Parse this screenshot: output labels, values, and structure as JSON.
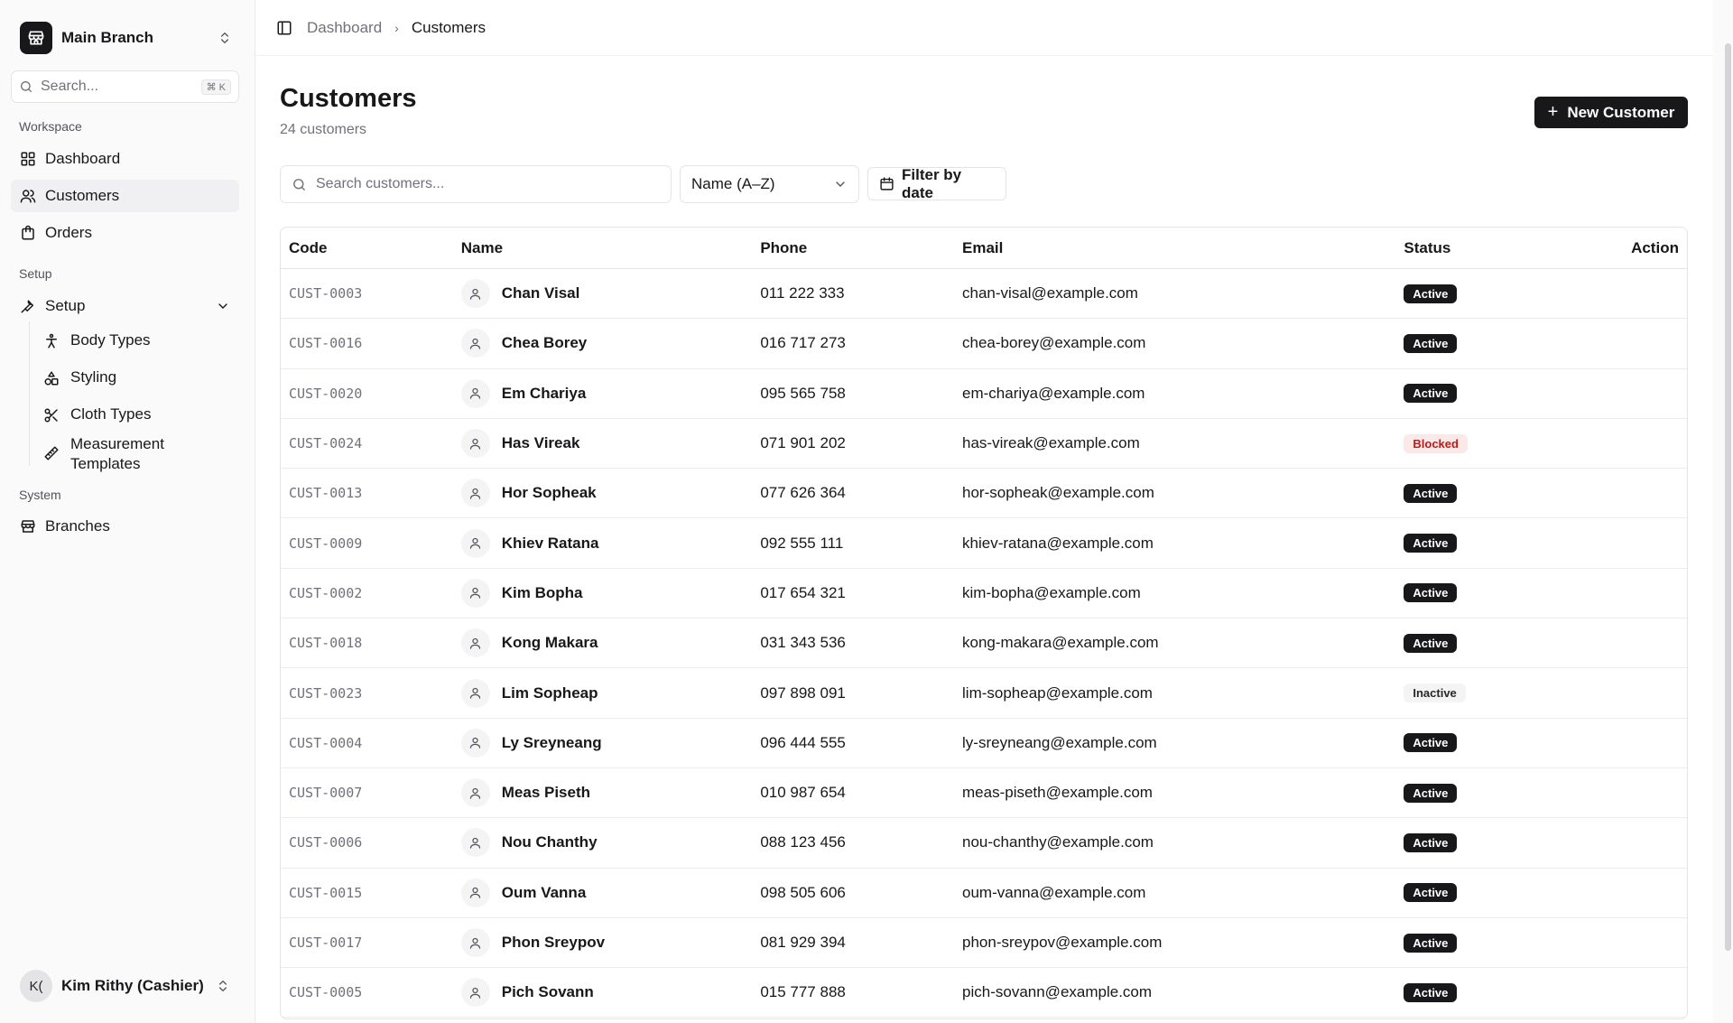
{
  "sidebar": {
    "branch_name": "Main Branch",
    "search_placeholder": "Search...",
    "search_shortcut": "⌘ K",
    "sections": {
      "workspace": "Workspace",
      "setup": "Setup",
      "system": "System"
    },
    "workspace_items": [
      {
        "label": "Dashboard",
        "icon": "grid-icon"
      },
      {
        "label": "Customers",
        "icon": "users-icon"
      },
      {
        "label": "Orders",
        "icon": "bag-icon"
      }
    ],
    "setup_group_label": "Setup",
    "setup_items": [
      {
        "label": "Body Types",
        "icon": "person-icon"
      },
      {
        "label": "Styling",
        "icon": "shapes-icon"
      },
      {
        "label": "Cloth Types",
        "icon": "scissors-icon"
      },
      {
        "label": "Measurement Templates",
        "icon": "ruler-icon"
      }
    ],
    "system_items": [
      {
        "label": "Branches",
        "icon": "store-icon"
      }
    ],
    "user": {
      "initials": "K(",
      "name": "Kim Rithy (Cashier)"
    }
  },
  "breadcrumb": {
    "parent": "Dashboard",
    "current": "Customers"
  },
  "page": {
    "title": "Customers",
    "count_text": "24 customers",
    "new_button": "New Customer"
  },
  "filters": {
    "search_placeholder": "Search customers...",
    "sort_value": "Name (A–Z)",
    "date_button": "Filter by date"
  },
  "table": {
    "headers": {
      "code": "Code",
      "name": "Name",
      "phone": "Phone",
      "email": "Email",
      "status": "Status",
      "action": "Action"
    },
    "rows": [
      {
        "code": "CUST-0003",
        "name": "Chan Visal",
        "phone": "011 222 333",
        "email": "chan-visal@example.com",
        "status": "Active"
      },
      {
        "code": "CUST-0016",
        "name": "Chea Borey",
        "phone": "016 717 273",
        "email": "chea-borey@example.com",
        "status": "Active"
      },
      {
        "code": "CUST-0020",
        "name": "Em Chariya",
        "phone": "095 565 758",
        "email": "em-chariya@example.com",
        "status": "Active"
      },
      {
        "code": "CUST-0024",
        "name": "Has Vireak",
        "phone": "071 901 202",
        "email": "has-vireak@example.com",
        "status": "Blocked"
      },
      {
        "code": "CUST-0013",
        "name": "Hor Sopheak",
        "phone": "077 626 364",
        "email": "hor-sopheak@example.com",
        "status": "Active"
      },
      {
        "code": "CUST-0009",
        "name": "Khiev Ratana",
        "phone": "092 555 111",
        "email": "khiev-ratana@example.com",
        "status": "Active"
      },
      {
        "code": "CUST-0002",
        "name": "Kim Bopha",
        "phone": "017 654 321",
        "email": "kim-bopha@example.com",
        "status": "Active"
      },
      {
        "code": "CUST-0018",
        "name": "Kong Makara",
        "phone": "031 343 536",
        "email": "kong-makara@example.com",
        "status": "Active"
      },
      {
        "code": "CUST-0023",
        "name": "Lim Sopheap",
        "phone": "097 898 091",
        "email": "lim-sopheap@example.com",
        "status": "Inactive"
      },
      {
        "code": "CUST-0004",
        "name": "Ly Sreyneang",
        "phone": "096 444 555",
        "email": "ly-sreyneang@example.com",
        "status": "Active"
      },
      {
        "code": "CUST-0007",
        "name": "Meas Piseth",
        "phone": "010 987 654",
        "email": "meas-piseth@example.com",
        "status": "Active"
      },
      {
        "code": "CUST-0006",
        "name": "Nou Chanthy",
        "phone": "088 123 456",
        "email": "nou-chanthy@example.com",
        "status": "Active"
      },
      {
        "code": "CUST-0015",
        "name": "Oum Vanna",
        "phone": "098 505 606",
        "email": "oum-vanna@example.com",
        "status": "Active"
      },
      {
        "code": "CUST-0017",
        "name": "Phon Sreypov",
        "phone": "081 929 394",
        "email": "phon-sreypov@example.com",
        "status": "Active"
      },
      {
        "code": "CUST-0005",
        "name": "Pich Sovann",
        "phone": "015 777 888",
        "email": "pich-sovann@example.com",
        "status": "Active"
      }
    ]
  },
  "colors": {
    "primary": "#18181b",
    "blocked_bg": "#fde8e8",
    "blocked_text": "#b91c1c",
    "muted": "#71717a"
  }
}
